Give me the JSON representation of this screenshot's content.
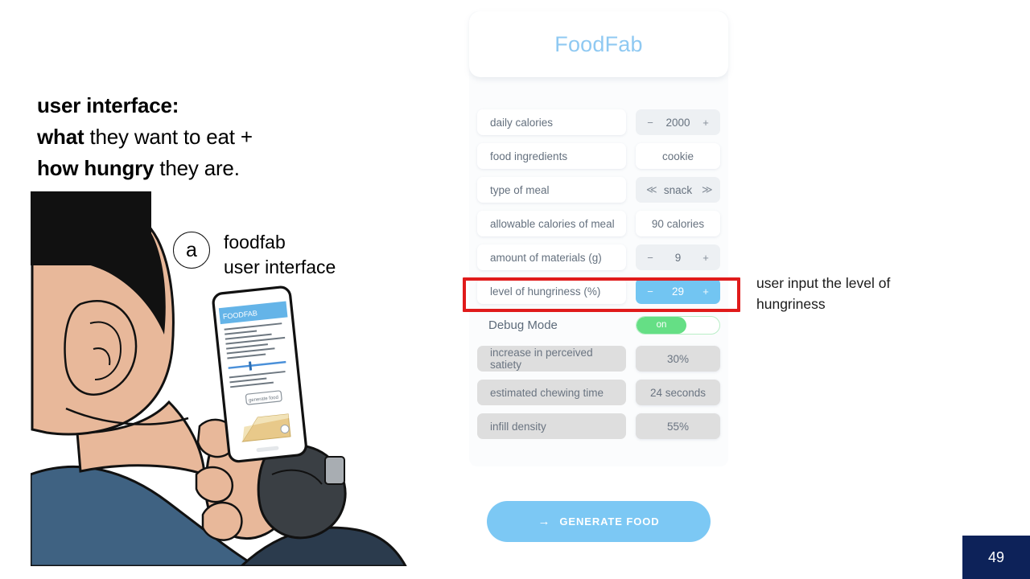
{
  "headline": {
    "line1_bold": "user interface:",
    "line2_bold": "what",
    "line2_rest": " they want to eat +",
    "line3_bold": "how hungry",
    "line3_rest": " they are."
  },
  "caption": {
    "marker": "a",
    "line1": "foodfab",
    "line2": "user interface"
  },
  "annotation": {
    "line1": "user input the level of",
    "line2": "hungriness"
  },
  "app": {
    "title": "FoodFab",
    "generate_button": {
      "arrow": "→",
      "label": "GENERATE FOOD"
    },
    "stepper_symbols": {
      "minus": "−",
      "plus": "+"
    },
    "carousel_symbols": {
      "prev": "≪",
      "next": "≫"
    },
    "rows": [
      {
        "label": "daily calories",
        "type": "stepper",
        "value": "2000",
        "active": false,
        "disabled": false
      },
      {
        "label": "food ingredients",
        "type": "value",
        "value": "cookie",
        "active": false,
        "disabled": false
      },
      {
        "label": "type of meal",
        "type": "carousel",
        "value": "snack",
        "active": false,
        "disabled": false
      },
      {
        "label": "allowable calories of meal",
        "type": "value",
        "value": "90 calories",
        "active": false,
        "disabled": false
      },
      {
        "label": "amount of materials (g)",
        "type": "stepper",
        "value": "9",
        "active": false,
        "disabled": false
      },
      {
        "label": "level of hungriness (%)",
        "type": "stepper",
        "value": "29",
        "active": true,
        "disabled": false
      },
      {
        "label": "Debug Mode",
        "type": "toggle",
        "value": "on",
        "active": false,
        "disabled": false
      },
      {
        "label": "increase in perceived satiety",
        "type": "value",
        "value": "30%",
        "active": false,
        "disabled": true
      },
      {
        "label": "estimated chewing time",
        "type": "value",
        "value": "24 seconds",
        "active": false,
        "disabled": true
      },
      {
        "label": "infill density",
        "type": "value",
        "value": "55%",
        "active": false,
        "disabled": true
      }
    ]
  },
  "phone_mockup": {
    "header": "FOODFAB",
    "button": "generate food"
  },
  "slide_number": "49",
  "colors": {
    "accent_blue": "#7cc8f4",
    "title_blue": "#8fc9f2",
    "toggle_green": "#65df85",
    "highlight_red": "#e01b1b",
    "slide_badge_navy": "#0d2259"
  }
}
